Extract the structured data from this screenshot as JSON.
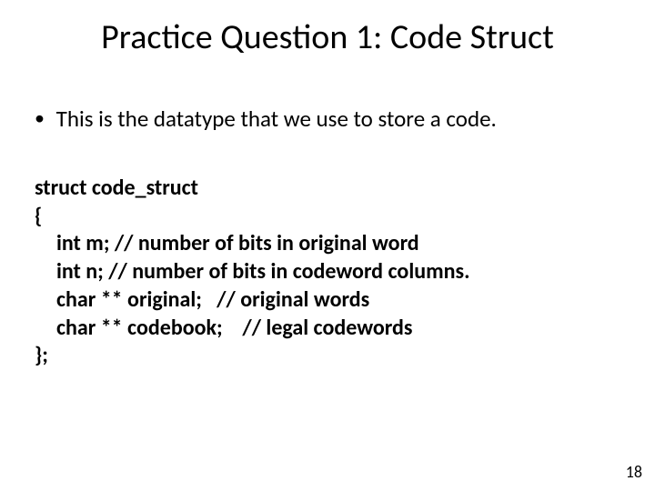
{
  "title": "Practice Question 1: Code Struct",
  "bullet": "This is the datatype that we use to store a code.",
  "code": {
    "l1": "struct code_struct",
    "l2": "{",
    "l3": "int m; // number of bits in original word",
    "l4": "int n; // number of bits in codeword columns.",
    "l5": "char ** original;   // original words",
    "l6": "char ** codebook;    // legal codewords",
    "l7": "};"
  },
  "page_number": "18"
}
